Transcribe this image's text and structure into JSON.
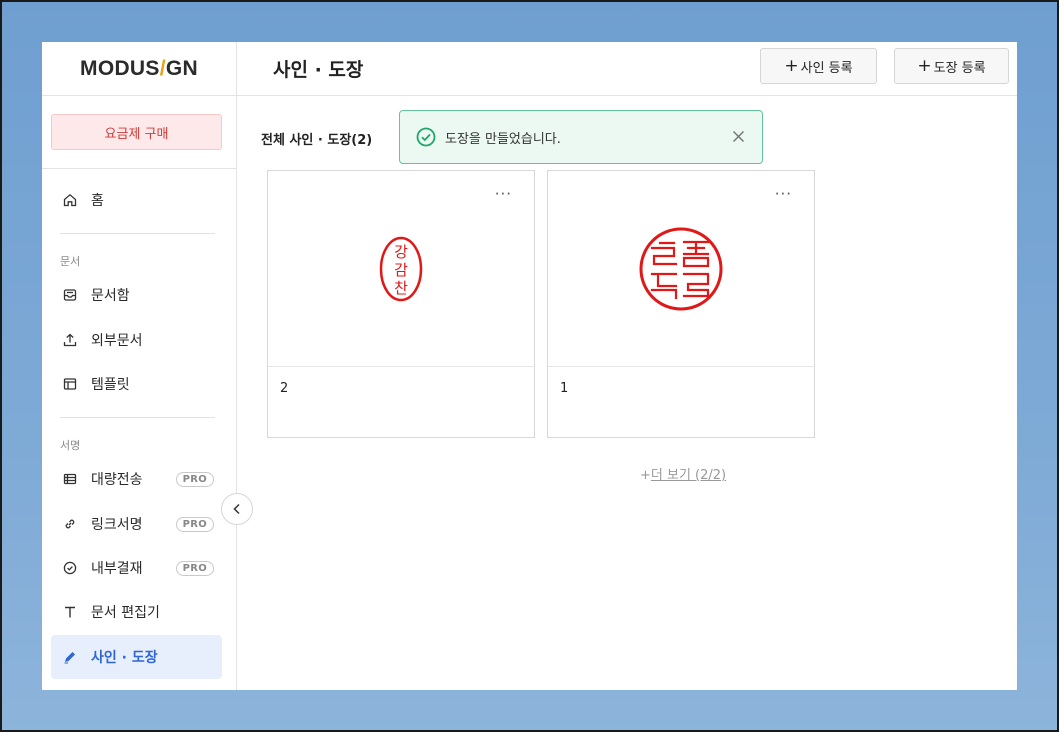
{
  "brand": {
    "logo_left": "MODUS",
    "logo_slash": "/",
    "logo_right": "GN"
  },
  "sidebar": {
    "plan_button": "요금제 구매",
    "home": "홈",
    "section_documents": "문서",
    "doc_items": [
      "문서함",
      "외부문서",
      "템플릿"
    ],
    "section_sign": "서명",
    "sign_items": [
      {
        "label": "대량전송",
        "badge": "PRO"
      },
      {
        "label": "링크서명",
        "badge": "PRO"
      },
      {
        "label": "내부결재",
        "badge": "PRO"
      },
      {
        "label": "문서 편집기"
      },
      {
        "label": "사인 · 도장"
      }
    ]
  },
  "header": {
    "title": "사인 · 도장",
    "register_sign": "사인 등록",
    "register_stamp": "도장 등록",
    "plus": "+"
  },
  "main": {
    "section_title": "전체 사인 · 도장(2)",
    "cards": [
      {
        "name": "2",
        "stamp_text": [
          "강",
          "감",
          "찬"
        ],
        "shape": "oval"
      },
      {
        "name": "1",
        "stamp_text": "",
        "shape": "circle"
      }
    ],
    "card_menu": "···",
    "more_plus": "+",
    "more_label": "더 보기 (2/2)"
  },
  "toast": {
    "message": "도장을 만들었습니다."
  },
  "colors": {
    "accent": "#2e66d6",
    "stamp_red": "#e01818",
    "success": "#1fa56b",
    "plan_red": "#d23a3a"
  }
}
